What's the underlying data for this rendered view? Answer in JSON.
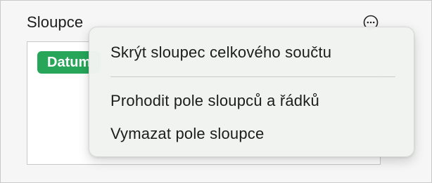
{
  "panel": {
    "section_title": "Sloupce",
    "more_icon": "ellipsis-circle-icon",
    "fields": [
      {
        "label": "Datum",
        "color": "#27a65a"
      }
    ]
  },
  "context_menu": {
    "items": [
      {
        "label": "Skrýt sloupec celkového součtu"
      },
      {
        "label": "Prohodit pole sloupců a řádků"
      },
      {
        "label": "Vymazat pole sloupce"
      }
    ]
  }
}
